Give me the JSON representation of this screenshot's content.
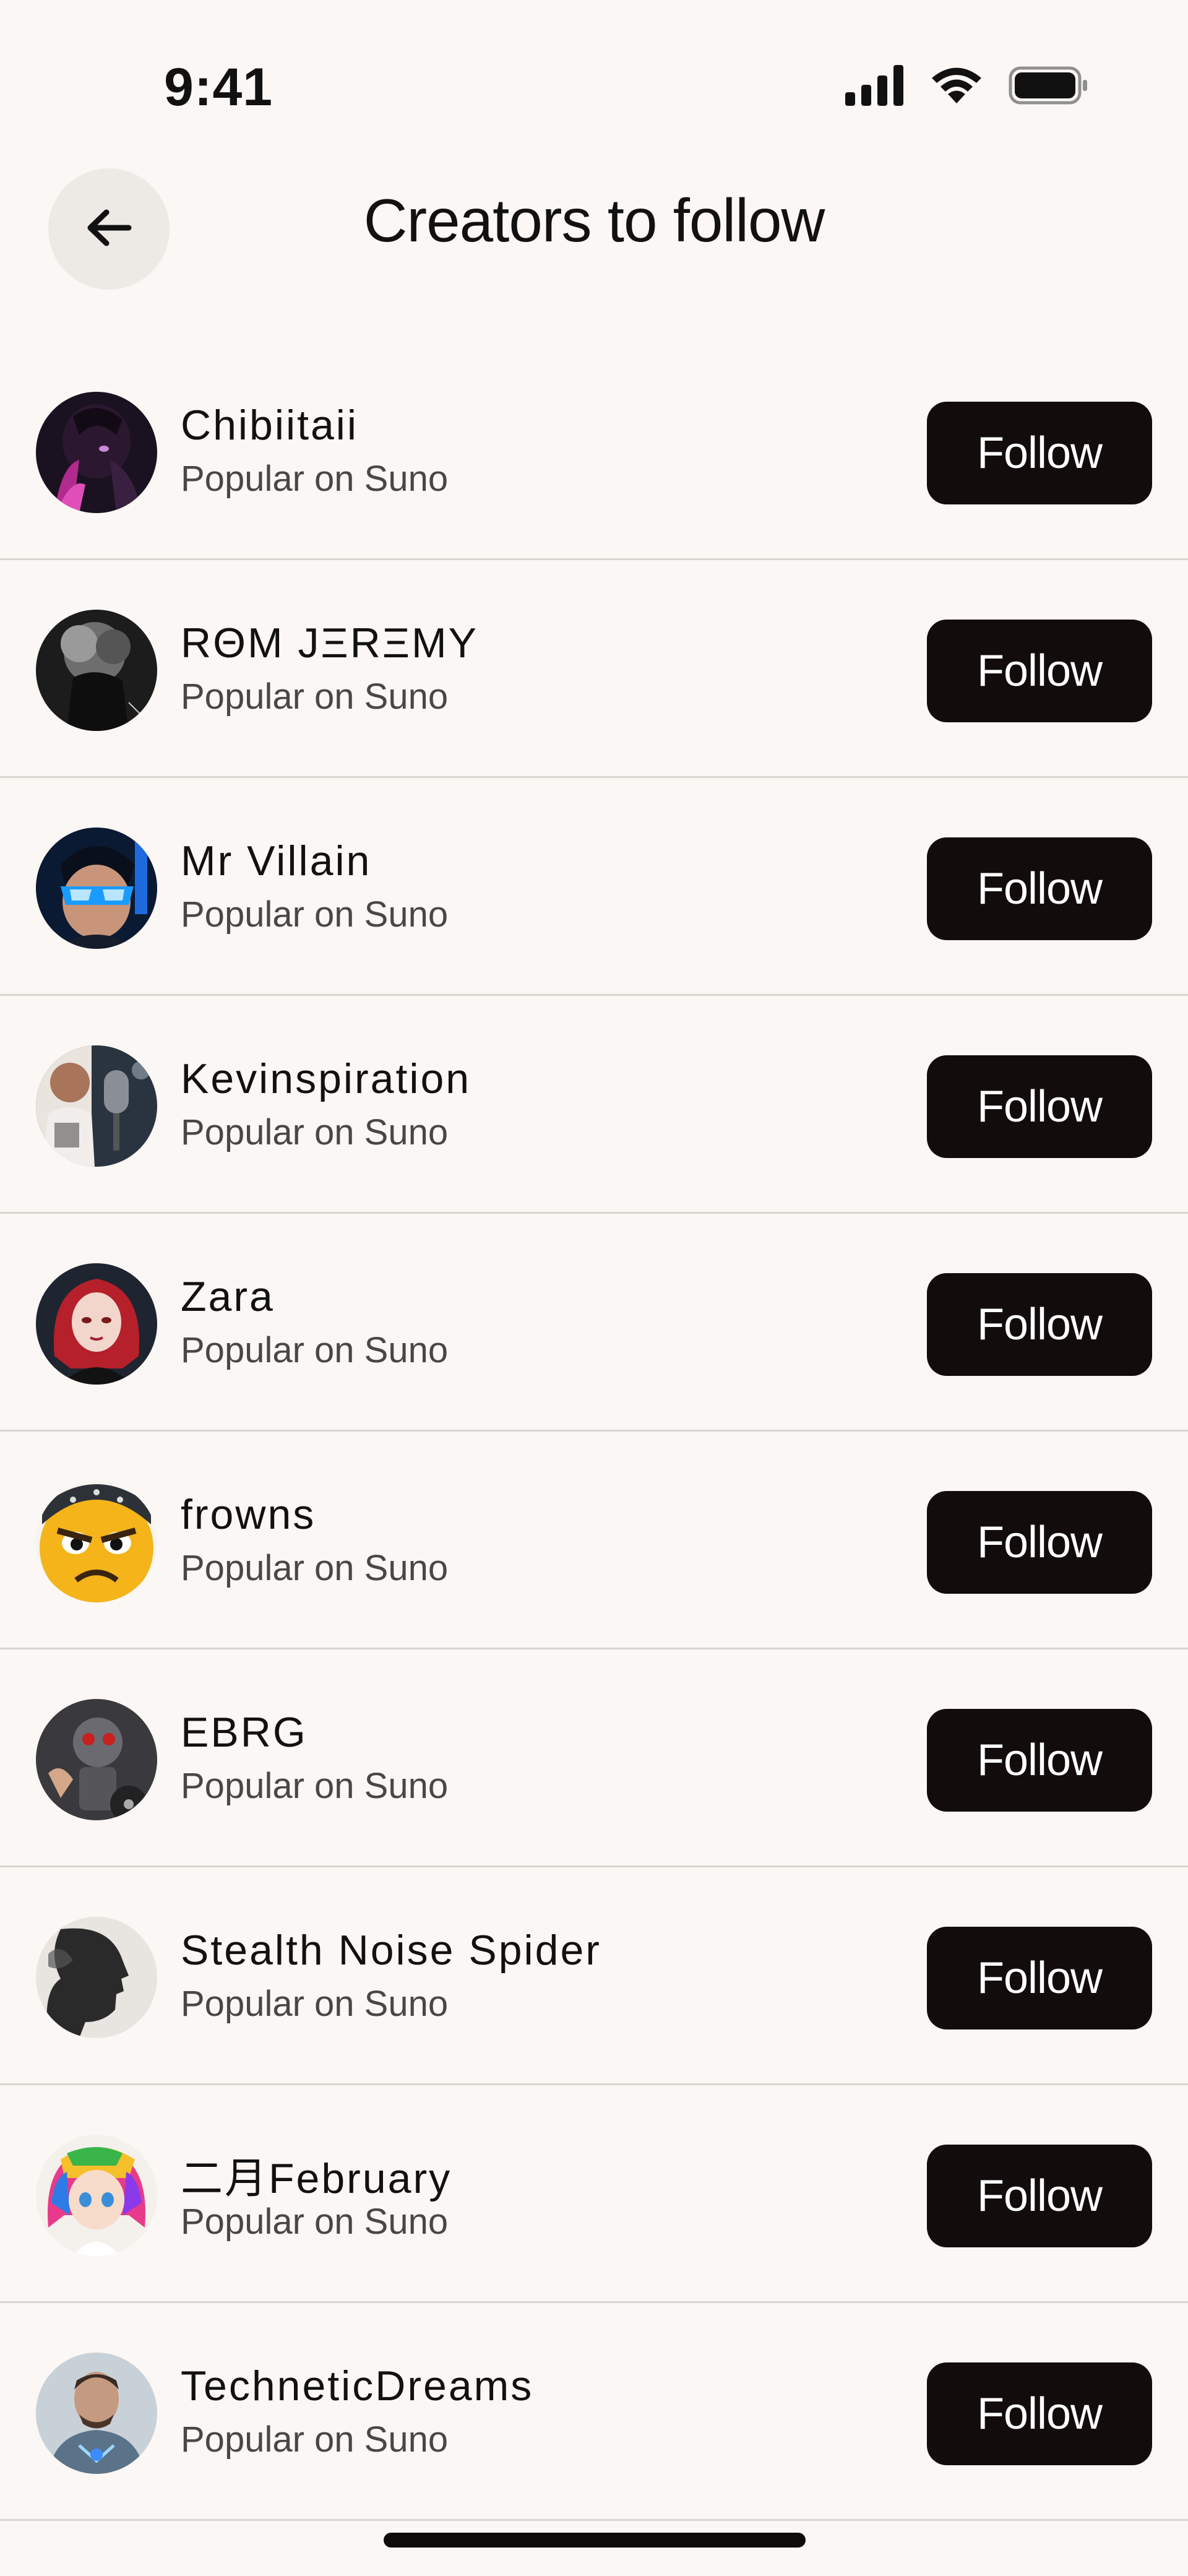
{
  "status_bar": {
    "time": "9:41",
    "icons": [
      "cellular-signal-icon",
      "wifi-icon",
      "battery-icon"
    ]
  },
  "header": {
    "back_icon": "arrow-left-icon",
    "title": "Creators to follow"
  },
  "colors": {
    "background": "#FAF7F4",
    "button": "#120D0C",
    "button_text": "#FFFFFF",
    "divider": "#D9D6D2",
    "subtitle": "#4A4645"
  },
  "creators": [
    {
      "name": "Chibiitaii",
      "subtitle": "Popular on Suno",
      "button": "Follow",
      "avatar": "avatar-chibiitaii"
    },
    {
      "name": "RΘM JΞRΞMY",
      "subtitle": "Popular on Suno",
      "button": "Follow",
      "avatar": "avatar-rom-jeremy"
    },
    {
      "name": "Mr Villain",
      "subtitle": "Popular on Suno",
      "button": "Follow",
      "avatar": "avatar-mr-villain"
    },
    {
      "name": "Kevinspiration",
      "subtitle": "Popular on Suno",
      "button": "Follow",
      "avatar": "avatar-kevinspiration"
    },
    {
      "name": "Zara",
      "subtitle": "Popular on Suno",
      "button": "Follow",
      "avatar": "avatar-zara"
    },
    {
      "name": "frowns",
      "subtitle": "Popular on Suno",
      "button": "Follow",
      "avatar": "avatar-frowns"
    },
    {
      "name": "EBRG",
      "subtitle": "Popular on Suno",
      "button": "Follow",
      "avatar": "avatar-ebrg"
    },
    {
      "name": "Stealth Noise Spider",
      "subtitle": "Popular on Suno",
      "button": "Follow",
      "avatar": "avatar-stealth-noise-spider"
    },
    {
      "name": "二月February",
      "subtitle": "Popular on Suno",
      "button": "Follow",
      "avatar": "avatar-february"
    },
    {
      "name": "TechneticDreams",
      "subtitle": "Popular on Suno",
      "button": "Follow",
      "avatar": "avatar-technetic-dreams"
    }
  ]
}
